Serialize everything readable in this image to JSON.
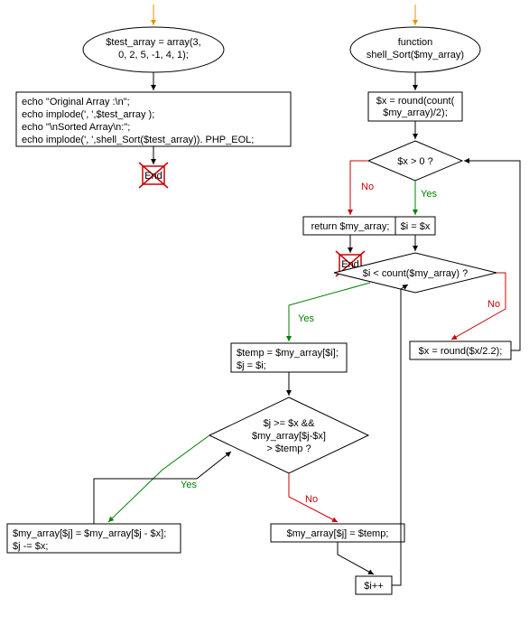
{
  "left": {
    "start": "$test_array = array(3, 0, 2, 5, -1, 4, 1);",
    "code": "echo \"Original Array :\\n\";\necho implode(', ',$test_array );\necho \"\\nSorted Array\\n:\";\necho implode(', ',shell_Sort($test_array)). PHP_EOL;",
    "end": "End"
  },
  "right": {
    "func": "function shell_Sort($my_array)",
    "xinit": "$x = round(count($my_array)/2);",
    "cond_x": "$x > 0 ?",
    "return": "return $my_array;",
    "end": "End",
    "iinit": "$i = $x",
    "cond_i": "$i < count($my_array) ?",
    "tempinit": "$temp = $my_array[$i];\n$j = $i;",
    "cond_j": "$j >= $x && $my_array[$j-$x] > $temp ?",
    "swap": "$my_array[$j] = $my_array[$j - $x];\n$j -= $x;",
    "assign_temp": "$my_array[$j] = $temp;",
    "incr": "$i++",
    "xupdate": "$x = round($x/2.2);"
  },
  "labels": {
    "yes": "Yes",
    "no": "No"
  }
}
